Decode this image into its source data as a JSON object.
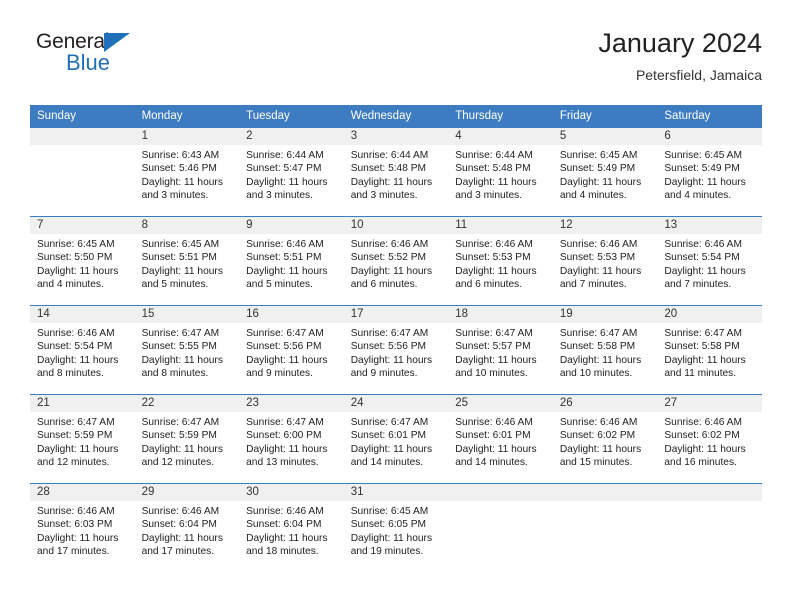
{
  "brand": {
    "line1": "General",
    "line2": "Blue",
    "triangle_color": "#1f70b8"
  },
  "header": {
    "title": "January 2024",
    "subtitle": "Petersfield, Jamaica"
  },
  "theme": {
    "header_blue": "#3d7cc0",
    "daynum_gray": "#f0f0f0",
    "text": "#222222"
  },
  "weekdays": [
    "Sunday",
    "Monday",
    "Tuesday",
    "Wednesday",
    "Thursday",
    "Friday",
    "Saturday"
  ],
  "weeks": [
    [
      {
        "day": "",
        "empty": true,
        "sunrise": "",
        "sunset": "",
        "daylight1": "",
        "daylight2": ""
      },
      {
        "day": "1",
        "sunrise": "Sunrise: 6:43 AM",
        "sunset": "Sunset: 5:46 PM",
        "daylight1": "Daylight: 11 hours",
        "daylight2": "and 3 minutes."
      },
      {
        "day": "2",
        "sunrise": "Sunrise: 6:44 AM",
        "sunset": "Sunset: 5:47 PM",
        "daylight1": "Daylight: 11 hours",
        "daylight2": "and 3 minutes."
      },
      {
        "day": "3",
        "sunrise": "Sunrise: 6:44 AM",
        "sunset": "Sunset: 5:48 PM",
        "daylight1": "Daylight: 11 hours",
        "daylight2": "and 3 minutes."
      },
      {
        "day": "4",
        "sunrise": "Sunrise: 6:44 AM",
        "sunset": "Sunset: 5:48 PM",
        "daylight1": "Daylight: 11 hours",
        "daylight2": "and 3 minutes."
      },
      {
        "day": "5",
        "sunrise": "Sunrise: 6:45 AM",
        "sunset": "Sunset: 5:49 PM",
        "daylight1": "Daylight: 11 hours",
        "daylight2": "and 4 minutes."
      },
      {
        "day": "6",
        "sunrise": "Sunrise: 6:45 AM",
        "sunset": "Sunset: 5:49 PM",
        "daylight1": "Daylight: 11 hours",
        "daylight2": "and 4 minutes."
      }
    ],
    [
      {
        "day": "7",
        "sunrise": "Sunrise: 6:45 AM",
        "sunset": "Sunset: 5:50 PM",
        "daylight1": "Daylight: 11 hours",
        "daylight2": "and 4 minutes."
      },
      {
        "day": "8",
        "sunrise": "Sunrise: 6:45 AM",
        "sunset": "Sunset: 5:51 PM",
        "daylight1": "Daylight: 11 hours",
        "daylight2": "and 5 minutes."
      },
      {
        "day": "9",
        "sunrise": "Sunrise: 6:46 AM",
        "sunset": "Sunset: 5:51 PM",
        "daylight1": "Daylight: 11 hours",
        "daylight2": "and 5 minutes."
      },
      {
        "day": "10",
        "sunrise": "Sunrise: 6:46 AM",
        "sunset": "Sunset: 5:52 PM",
        "daylight1": "Daylight: 11 hours",
        "daylight2": "and 6 minutes."
      },
      {
        "day": "11",
        "sunrise": "Sunrise: 6:46 AM",
        "sunset": "Sunset: 5:53 PM",
        "daylight1": "Daylight: 11 hours",
        "daylight2": "and 6 minutes."
      },
      {
        "day": "12",
        "sunrise": "Sunrise: 6:46 AM",
        "sunset": "Sunset: 5:53 PM",
        "daylight1": "Daylight: 11 hours",
        "daylight2": "and 7 minutes."
      },
      {
        "day": "13",
        "sunrise": "Sunrise: 6:46 AM",
        "sunset": "Sunset: 5:54 PM",
        "daylight1": "Daylight: 11 hours",
        "daylight2": "and 7 minutes."
      }
    ],
    [
      {
        "day": "14",
        "sunrise": "Sunrise: 6:46 AM",
        "sunset": "Sunset: 5:54 PM",
        "daylight1": "Daylight: 11 hours",
        "daylight2": "and 8 minutes."
      },
      {
        "day": "15",
        "sunrise": "Sunrise: 6:47 AM",
        "sunset": "Sunset: 5:55 PM",
        "daylight1": "Daylight: 11 hours",
        "daylight2": "and 8 minutes."
      },
      {
        "day": "16",
        "sunrise": "Sunrise: 6:47 AM",
        "sunset": "Sunset: 5:56 PM",
        "daylight1": "Daylight: 11 hours",
        "daylight2": "and 9 minutes."
      },
      {
        "day": "17",
        "sunrise": "Sunrise: 6:47 AM",
        "sunset": "Sunset: 5:56 PM",
        "daylight1": "Daylight: 11 hours",
        "daylight2": "and 9 minutes."
      },
      {
        "day": "18",
        "sunrise": "Sunrise: 6:47 AM",
        "sunset": "Sunset: 5:57 PM",
        "daylight1": "Daylight: 11 hours",
        "daylight2": "and 10 minutes."
      },
      {
        "day": "19",
        "sunrise": "Sunrise: 6:47 AM",
        "sunset": "Sunset: 5:58 PM",
        "daylight1": "Daylight: 11 hours",
        "daylight2": "and 10 minutes."
      },
      {
        "day": "20",
        "sunrise": "Sunrise: 6:47 AM",
        "sunset": "Sunset: 5:58 PM",
        "daylight1": "Daylight: 11 hours",
        "daylight2": "and 11 minutes."
      }
    ],
    [
      {
        "day": "21",
        "sunrise": "Sunrise: 6:47 AM",
        "sunset": "Sunset: 5:59 PM",
        "daylight1": "Daylight: 11 hours",
        "daylight2": "and 12 minutes."
      },
      {
        "day": "22",
        "sunrise": "Sunrise: 6:47 AM",
        "sunset": "Sunset: 5:59 PM",
        "daylight1": "Daylight: 11 hours",
        "daylight2": "and 12 minutes."
      },
      {
        "day": "23",
        "sunrise": "Sunrise: 6:47 AM",
        "sunset": "Sunset: 6:00 PM",
        "daylight1": "Daylight: 11 hours",
        "daylight2": "and 13 minutes."
      },
      {
        "day": "24",
        "sunrise": "Sunrise: 6:47 AM",
        "sunset": "Sunset: 6:01 PM",
        "daylight1": "Daylight: 11 hours",
        "daylight2": "and 14 minutes."
      },
      {
        "day": "25",
        "sunrise": "Sunrise: 6:46 AM",
        "sunset": "Sunset: 6:01 PM",
        "daylight1": "Daylight: 11 hours",
        "daylight2": "and 14 minutes."
      },
      {
        "day": "26",
        "sunrise": "Sunrise: 6:46 AM",
        "sunset": "Sunset: 6:02 PM",
        "daylight1": "Daylight: 11 hours",
        "daylight2": "and 15 minutes."
      },
      {
        "day": "27",
        "sunrise": "Sunrise: 6:46 AM",
        "sunset": "Sunset: 6:02 PM",
        "daylight1": "Daylight: 11 hours",
        "daylight2": "and 16 minutes."
      }
    ],
    [
      {
        "day": "28",
        "sunrise": "Sunrise: 6:46 AM",
        "sunset": "Sunset: 6:03 PM",
        "daylight1": "Daylight: 11 hours",
        "daylight2": "and 17 minutes."
      },
      {
        "day": "29",
        "sunrise": "Sunrise: 6:46 AM",
        "sunset": "Sunset: 6:04 PM",
        "daylight1": "Daylight: 11 hours",
        "daylight2": "and 17 minutes."
      },
      {
        "day": "30",
        "sunrise": "Sunrise: 6:46 AM",
        "sunset": "Sunset: 6:04 PM",
        "daylight1": "Daylight: 11 hours",
        "daylight2": "and 18 minutes."
      },
      {
        "day": "31",
        "sunrise": "Sunrise: 6:45 AM",
        "sunset": "Sunset: 6:05 PM",
        "daylight1": "Daylight: 11 hours",
        "daylight2": "and 19 minutes."
      },
      {
        "day": "",
        "empty": true,
        "sunrise": "",
        "sunset": "",
        "daylight1": "",
        "daylight2": ""
      },
      {
        "day": "",
        "empty": true,
        "sunrise": "",
        "sunset": "",
        "daylight1": "",
        "daylight2": ""
      },
      {
        "day": "",
        "empty": true,
        "sunrise": "",
        "sunset": "",
        "daylight1": "",
        "daylight2": ""
      }
    ]
  ]
}
